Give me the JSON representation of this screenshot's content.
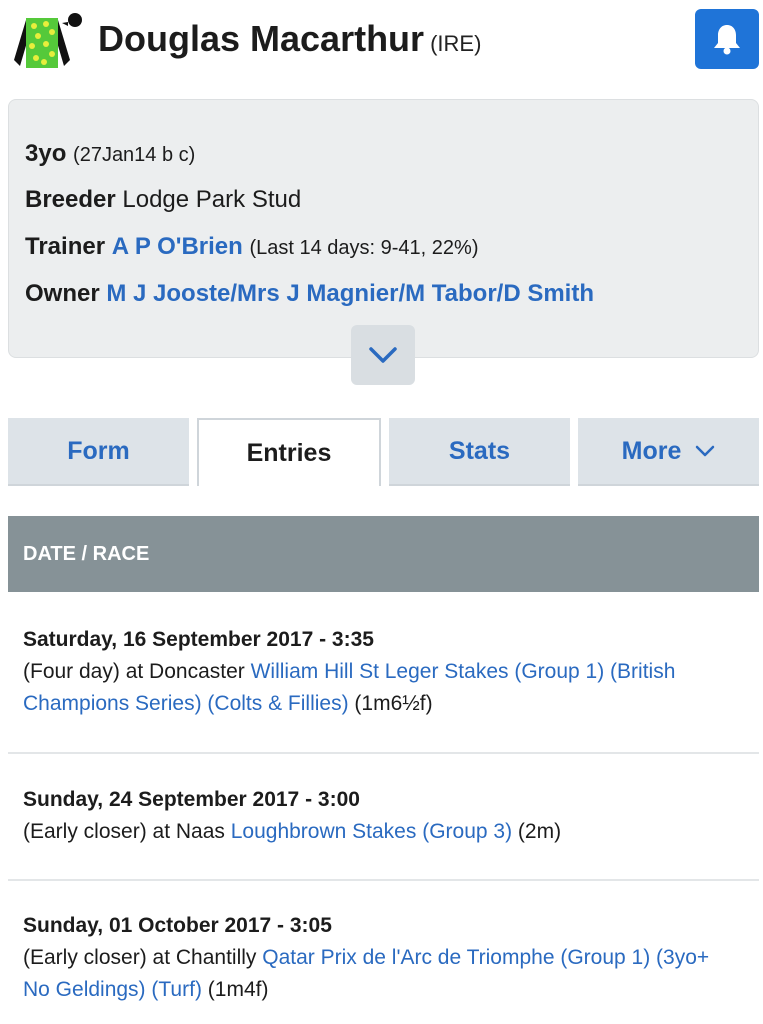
{
  "horse": {
    "name": "Douglas Macarthur",
    "country": "(IRE)"
  },
  "colors": {
    "accent": "#1f74d8",
    "link": "#2a6ac0",
    "table_header_bg": "#869297",
    "silks_green": "#55c93a",
    "silks_yellow": "#e7ee3c"
  },
  "icons": {
    "silks": "jockey-silks-icon",
    "bell": "bell-icon",
    "expand": "chevron-down-icon"
  },
  "details": {
    "age_label": "3yo",
    "age_detail": "(27Jan14 b c)",
    "breeder_label": "Breeder",
    "breeder_value": "Lodge Park Stud",
    "trainer_label": "Trainer",
    "trainer_value": "A P O'Brien",
    "trainer_stats": "(Last 14 days: 9-41, 22%)",
    "owner_label": "Owner",
    "owner_value": "M J Jooste/Mrs J Magnier/M Tabor/D Smith"
  },
  "tabs": [
    {
      "label": "Form"
    },
    {
      "label": "Entries"
    },
    {
      "label": "Stats"
    },
    {
      "label": "More"
    }
  ],
  "active_tab": "Entries",
  "table": {
    "header": "DATE / RACE",
    "entries": [
      {
        "when": "Saturday, 16 September 2017 - 3:35",
        "prefix": "(Four day) at Doncaster ",
        "race": "William Hill St Leger Stakes (Group 1) (British Champions Series) (Colts & Fillies)",
        "distance": " (1m6½f)"
      },
      {
        "when": "Sunday, 24 September 2017 - 3:00",
        "prefix": "(Early closer) at Naas ",
        "race": "Loughbrown Stakes (Group 3)",
        "distance": " (2m)"
      },
      {
        "when": "Sunday, 01 October 2017 - 3:05",
        "prefix": "(Early closer) at Chantilly ",
        "race": "Qatar Prix de l'Arc de Triomphe (Group 1) (3yo+ No Geldings) (Turf)",
        "distance": " (1m4f)"
      }
    ]
  }
}
